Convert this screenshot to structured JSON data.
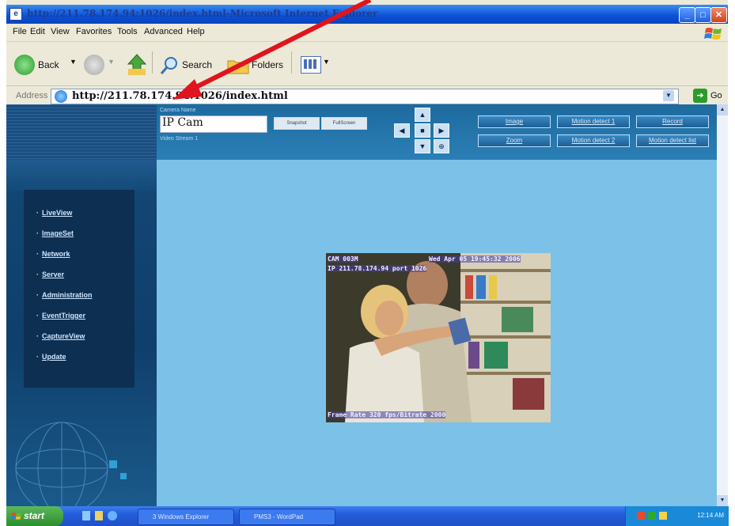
{
  "window": {
    "title": "http://211.78.174.94:1026/index.html-Microsoft Internet Explorer"
  },
  "menu": [
    "File",
    "Edit",
    "View",
    "Favorites",
    "Tools",
    "Advanced",
    "Help"
  ],
  "toolbar": {
    "back_label": "Back",
    "search_label": "Search",
    "folders_label": "Folders"
  },
  "address": {
    "label": "Address",
    "url": "http://211.78.174.94:1026/index.html",
    "go_label": "Go"
  },
  "camera": {
    "name_label": "Camera Name",
    "name": "IP Cam",
    "view_label": "Video Stream 1",
    "snapshot_label": "Snapshot",
    "fullscreen_label": "FullScreen"
  },
  "config_buttons": [
    "Image",
    "Motion detect 1",
    "Record",
    "Zoom",
    "Motion detect 2",
    "Motion detect list"
  ],
  "sidebar": {
    "items": [
      "LiveView",
      "ImageSet",
      "Network",
      "Server",
      "Administration",
      "EventTrigger",
      "CaptureView",
      "Update"
    ]
  },
  "video": {
    "osd_top_left": "CAM 003M",
    "osd_top_right": "Wed Apr 05 19:45:32 2006",
    "osd_line2": "IP 211.78.174.94 port 1026",
    "osd_bottom": "Frame Rate 320 fps/Bitrate 2000"
  },
  "taskbar": {
    "start_label": "start",
    "tasks": [
      "3 Windows Explorer",
      "PMS3 - WordPad"
    ],
    "clock": "12:14 AM"
  },
  "colors": {
    "annotation_arrow": "#e0141e",
    "content_bg": "#7cc1e8",
    "sidebar_bg": "#134a78"
  }
}
